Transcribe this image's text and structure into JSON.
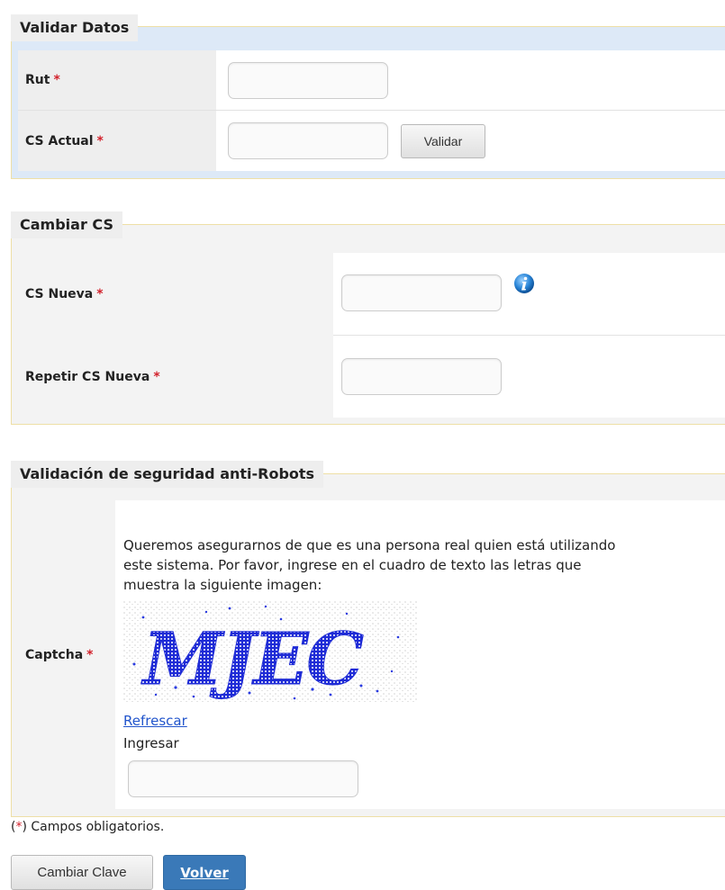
{
  "validar": {
    "legend": "Validar Datos",
    "rut_label": "Rut",
    "cs_actual_label": "CS Actual",
    "required_mark": "*",
    "validar_button": "Validar"
  },
  "cambiar": {
    "legend": "Cambiar CS",
    "cs_nueva_label": "CS Nueva",
    "repetir_label": "Repetir CS Nueva",
    "required_mark": "*"
  },
  "robots": {
    "legend": "Validación de seguridad anti-Robots",
    "captcha_label": "Captcha",
    "required_mark": "*",
    "instructions_line1": "Queremos asegurarnos de que es una persona real quien está utilizando",
    "instructions_line2": "este sistema. Por favor, ingrese en el cuadro de texto las letras que",
    "instructions_line3": "muestra la siguiente imagen:",
    "captcha_image_text": "MJEC",
    "refresh_link": "Refrescar",
    "ingresar_label": "Ingresar"
  },
  "footer": {
    "required_open": "(",
    "required_star": "*",
    "required_note": ") Campos obligatorios.",
    "cambiar_button": "Cambiar Clave",
    "volver_button": "Volver"
  },
  "colors": {
    "required": "#d2212b",
    "link": "#2255cc",
    "primary_button": "#3a79b8",
    "section_band": "#dde9f7",
    "fieldset_border": "#eedfa6"
  }
}
